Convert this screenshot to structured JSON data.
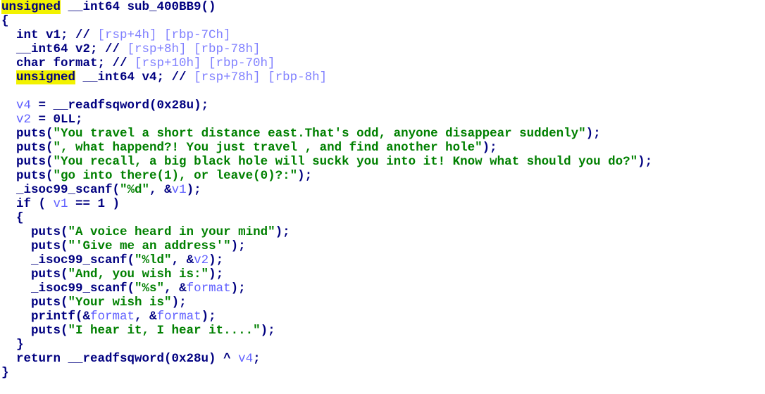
{
  "function": {
    "signature_prefix": "unsigned",
    "signature_rest": " __int64 sub_400BB9()"
  },
  "lines": {
    "l1": "{",
    "l2a": "  int v1; // ",
    "l2b": "[rsp+4h] [rbp-7Ch]",
    "l3a": "  __int64 v2; // ",
    "l3b": "[rsp+8h] [rbp-78h]",
    "l4a": "  char format; // ",
    "l4b": "[rsp+10h] [rbp-70h]",
    "l5a": "  ",
    "l5kw": "unsigned",
    "l5b": " __int64 v4; // ",
    "l5c": "[rsp+78h] [rbp-8h]",
    "l7v": "v4",
    "l7b": " = __readfsqword(0x28u);",
    "l8v": "v2",
    "l8b": " = 0LL;",
    "l9a": "puts(",
    "l9s": "\"You travel a short distance east.That's odd, anyone disappear suddenly\"",
    "l9b": ");",
    "l10a": "puts(",
    "l10s": "\", what happend?! You just travel , and find another hole\"",
    "l10b": ");",
    "l11a": "puts(",
    "l11s": "\"You recall, a big black hole will suckk you into it! Know what should you do?\"",
    "l11b": ");",
    "l12a": "puts(",
    "l12s": "\"go into there(1), or leave(0)?:\"",
    "l12b": ");",
    "l13a": "_isoc99_scanf(",
    "l13s": "\"%d\"",
    "l13b": ", &",
    "l13v": "v1",
    "l13c": ");",
    "l14a": "if ( ",
    "l14v": "v1",
    "l14b": " == 1 )",
    "l15": "{",
    "l16a": "puts(",
    "l16s": "\"A voice heard in your mind\"",
    "l16b": ");",
    "l17a": "puts(",
    "l17s": "\"'Give me an address'\"",
    "l17b": ");",
    "l18a": "_isoc99_scanf(",
    "l18s": "\"%ld\"",
    "l18b": ", &",
    "l18v": "v2",
    "l18c": ");",
    "l19a": "puts(",
    "l19s": "\"And, you wish is:\"",
    "l19b": ");",
    "l20a": "_isoc99_scanf(",
    "l20s": "\"%s\"",
    "l20b": ", &",
    "l20v": "format",
    "l20c": ");",
    "l21a": "puts(",
    "l21s": "\"Your wish is\"",
    "l21b": ");",
    "l22a": "printf(&",
    "l22v1": "format",
    "l22b": ", &",
    "l22v2": "format",
    "l22c": ");",
    "l23a": "puts(",
    "l23s": "\"I hear it, I hear it....\"",
    "l23b": ");",
    "l24": "}",
    "l25a": "return __readfsqword(0x28u) ^ ",
    "l25v": "v4",
    "l25b": ";",
    "l26": "}"
  },
  "colors": {
    "keyword_highlight": "#f2f200",
    "code_text": "#000080",
    "string": "#008000",
    "variable": "#6060ff",
    "stack_comment": "#8080ff"
  }
}
